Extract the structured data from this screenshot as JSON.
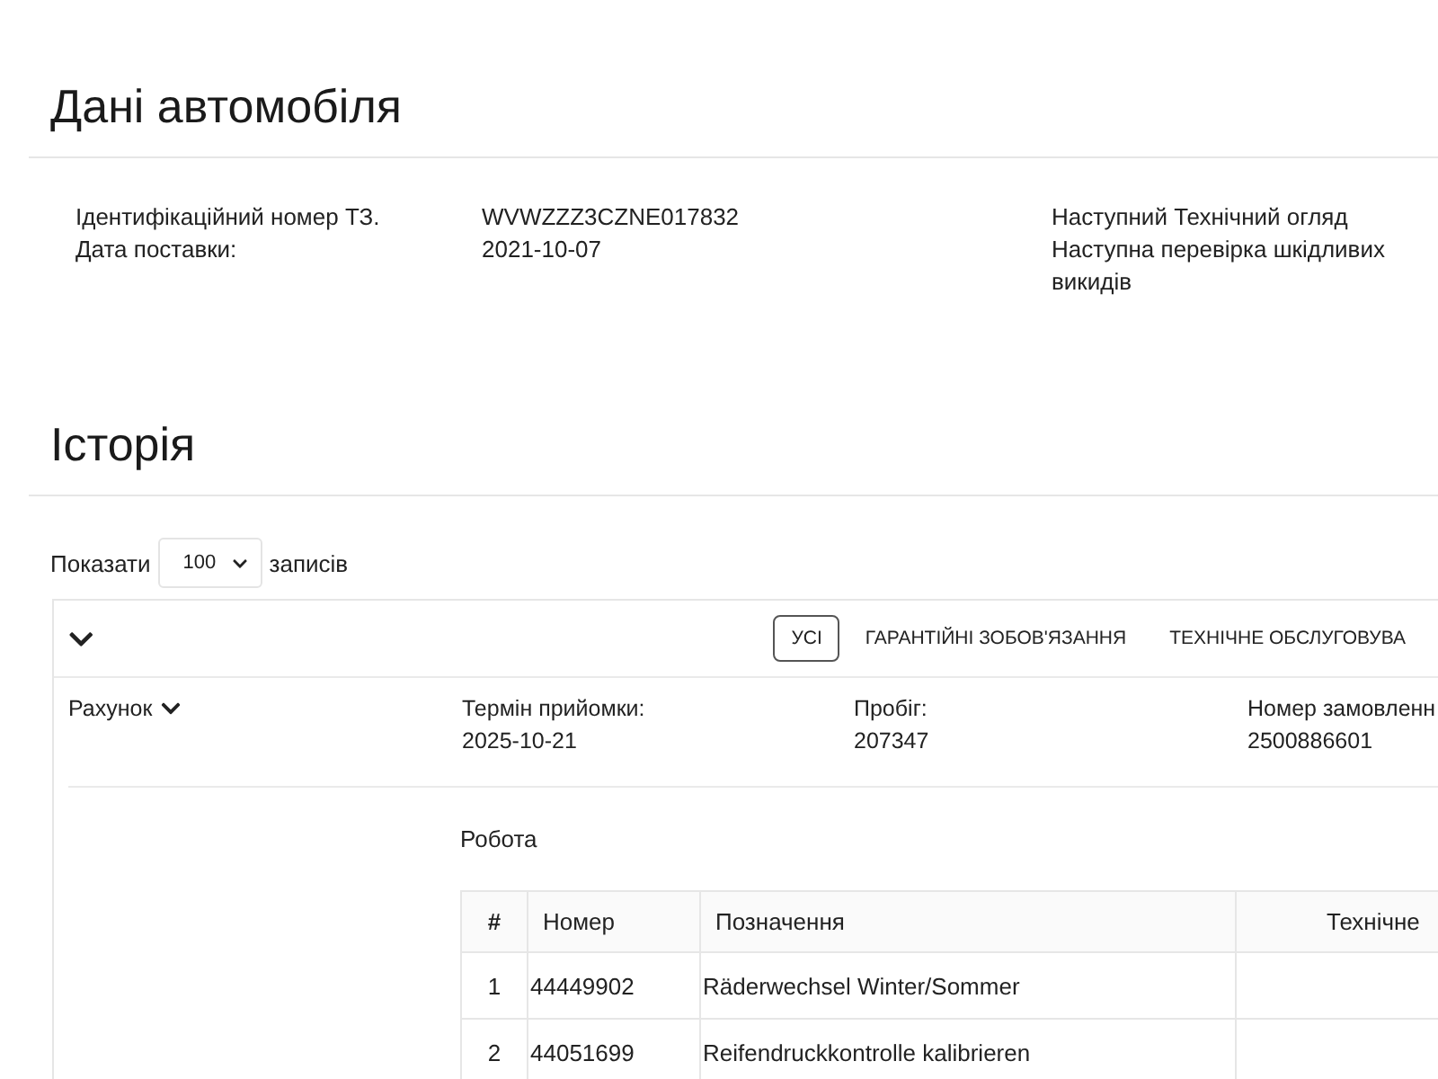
{
  "vehicle": {
    "title": "Дані автомобіля",
    "fields": [
      {
        "label": "Ідентифікаційний номер ТЗ.",
        "value": "WVWZZZ3CZNE017832"
      },
      {
        "label": "Дата поставки:",
        "value": "2021-10-07"
      }
    ],
    "inspections": [
      "Наступний Технічний огляд",
      "Наступна перевірка шкідливих викидів"
    ]
  },
  "history": {
    "title": "Історія",
    "page_size": {
      "label": "Показати",
      "value": "100",
      "suffix": "записів"
    },
    "filters": [
      {
        "label": "УСІ",
        "selected": true
      },
      {
        "label": "ГАРАНТІЙНІ ЗОБОВ'ЯЗАННЯ",
        "selected": false
      },
      {
        "label": "ТЕХНІЧНЕ ОБСЛУГОВУВА",
        "selected": false
      }
    ],
    "record": {
      "title": "Рахунок",
      "fields": [
        {
          "label": "Термін прийомки:",
          "value": "2025-10-21"
        },
        {
          "label": "Пробіг:",
          "value": "207347"
        },
        {
          "label": "Номер замовленн",
          "value": "2500886601"
        }
      ]
    },
    "work": {
      "title": "Робота",
      "columns": [
        "#",
        "Номер",
        "Позначення",
        "Технічне"
      ],
      "rows": [
        {
          "index": "1",
          "number": "44449902",
          "designation": "Räderwechsel Winter/Sommer"
        },
        {
          "index": "2",
          "number": "44051699",
          "designation": "Reifendruckkontrolle kalibrieren"
        }
      ]
    }
  }
}
